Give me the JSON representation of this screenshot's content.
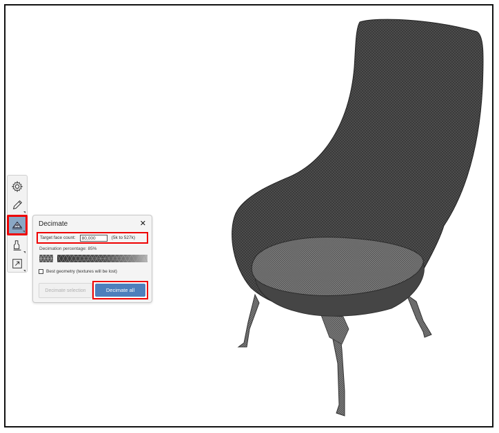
{
  "toolbar": {
    "tools": [
      {
        "icon": "gear-icon"
      },
      {
        "icon": "pencil-icon"
      },
      {
        "icon": "decimate-icon",
        "active": true
      },
      {
        "icon": "bucket-icon"
      },
      {
        "icon": "export-icon"
      }
    ]
  },
  "panel": {
    "title": "Decimate",
    "close_glyph": "✕",
    "target_face_label": "Target face count:",
    "target_face_value": "80,000",
    "target_face_range": "(5k to 527k)",
    "decimation_percentage_label": "Decimation percentage:  85%",
    "best_geometry_label": "Best geometry (textures will be lost)",
    "best_geometry_checked": false,
    "decimate_selection_label": "Decimate selection",
    "decimate_all_label": "Decimate all"
  },
  "colors": {
    "highlight": "#e00000",
    "primary_button": "#4d7fbc",
    "mesh": "#3b3b3b"
  }
}
